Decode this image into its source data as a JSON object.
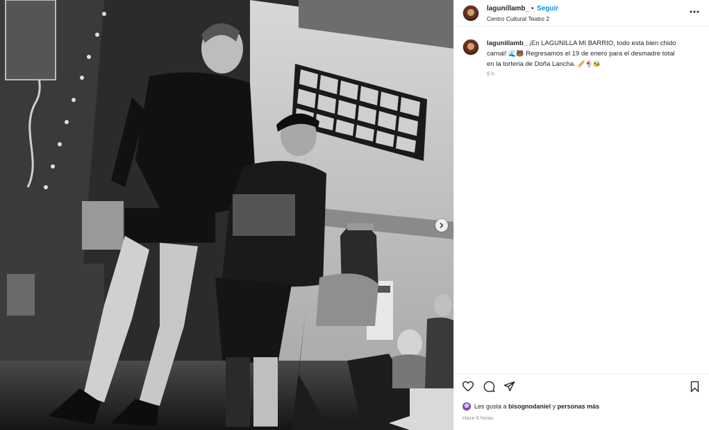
{
  "header": {
    "username": "lagunillamb_",
    "separator": "•",
    "follow_label": "Seguir",
    "location": "Centro Cultural Teatro 2",
    "more_icon": "more-horizontal-icon"
  },
  "caption": {
    "username": "lagunillamb_",
    "line1": "¡En LAGUNILLA MI BARRIO, todo esta bien chido",
    "line2_text": "carnal!",
    "line2_emojis": "🌊🐻",
    "line2_rest": "Regresamos el 19 de enero para el desmadre total",
    "line3_text": "en la torteria de Doña Lancha.",
    "line3_emojis": "🥖🍨🐝",
    "time": "6 h"
  },
  "actions": {
    "like_icon": "heart-icon",
    "comment_icon": "comment-icon",
    "share_icon": "send-icon",
    "save_icon": "bookmark-icon"
  },
  "likes": {
    "prefix": "Les gusta a",
    "user": "bisognodaniel",
    "middle": "y",
    "suffix": "personas más"
  },
  "post_time": "Hace 6 horas",
  "photo": {
    "alt": "Black and white stage photo of theater actors",
    "next_icon": "chevron-right-icon"
  },
  "colors": {
    "accent": "#0095f6",
    "text": "#262626",
    "muted": "#8e8e8e"
  }
}
